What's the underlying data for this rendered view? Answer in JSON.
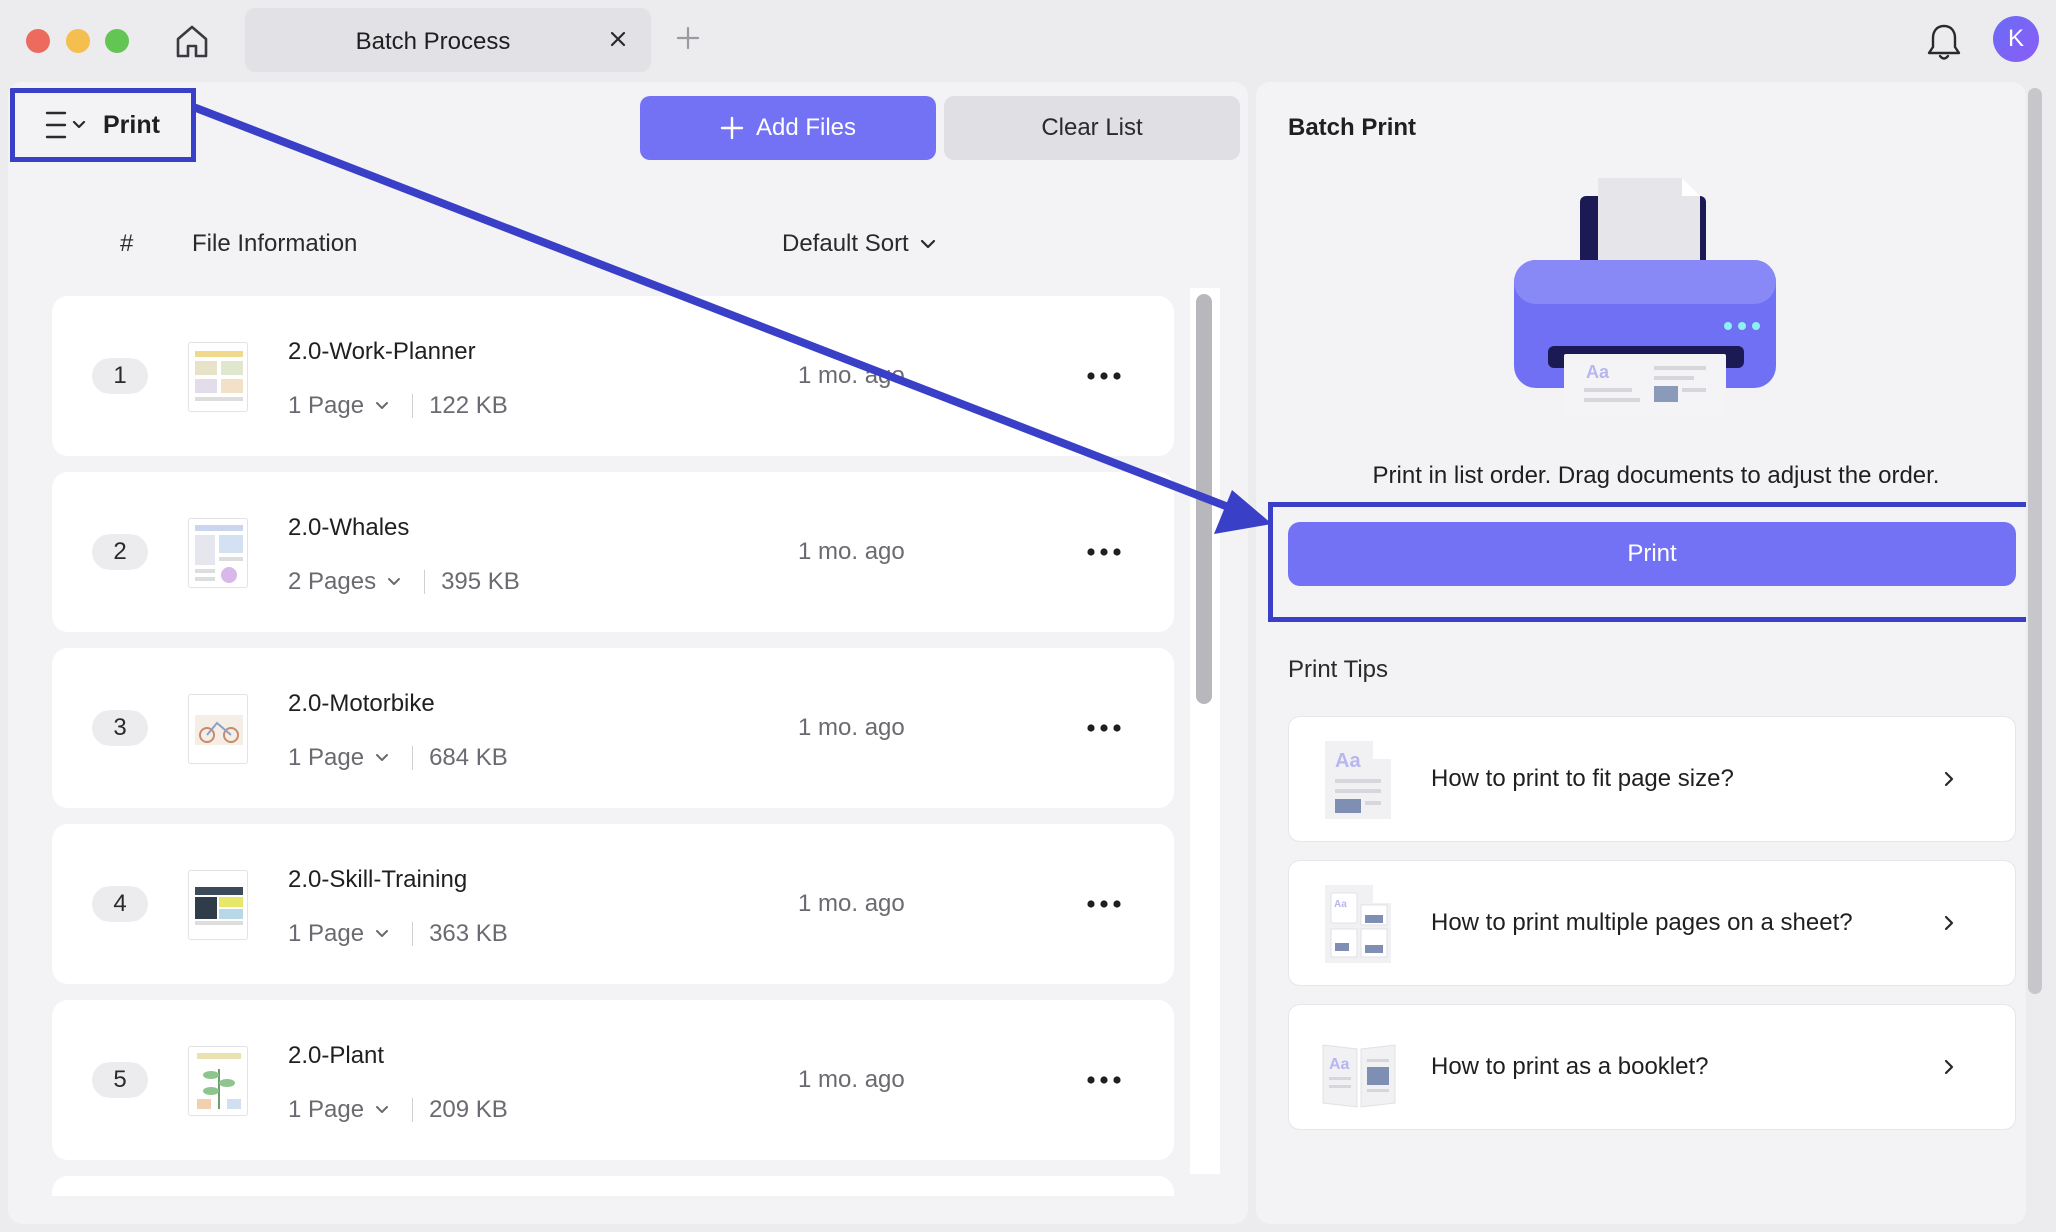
{
  "window": {
    "tab_title": "Batch Process",
    "avatar_initial": "K"
  },
  "colors": {
    "accent": "#7372f5",
    "annotation": "#3a3fc8",
    "traffic_red": "#ed6a5e",
    "traffic_yellow": "#f5bf4f",
    "traffic_green": "#62c554"
  },
  "toolbar": {
    "mode_label": "Print",
    "add_files_label": "Add Files",
    "clear_list_label": "Clear List"
  },
  "list": {
    "header": {
      "number": "#",
      "info": "File Information",
      "sort": "Default Sort"
    },
    "files": [
      {
        "index": "1",
        "name": "2.0-Work-Planner",
        "pages": "1 Page",
        "size": "122 KB",
        "modified": "1 mo. ago",
        "thumb": "planner"
      },
      {
        "index": "2",
        "name": "2.0-Whales",
        "pages": "2 Pages",
        "size": "395 KB",
        "modified": "1 mo. ago",
        "thumb": "whales"
      },
      {
        "index": "3",
        "name": "2.0-Motorbike",
        "pages": "1 Page",
        "size": "684 KB",
        "modified": "1 mo. ago",
        "thumb": "motorbike"
      },
      {
        "index": "4",
        "name": "2.0-Skill-Training",
        "pages": "1 Page",
        "size": "363 KB",
        "modified": "1 mo. ago",
        "thumb": "training"
      },
      {
        "index": "5",
        "name": "2.0-Plant",
        "pages": "1 Page",
        "size": "209 KB",
        "modified": "1 mo. ago",
        "thumb": "plant"
      }
    ]
  },
  "right_panel": {
    "title": "Batch Print",
    "description": "Print in list order. Drag documents to adjust the order.",
    "print_label": "Print",
    "tips_title": "Print Tips",
    "tips": [
      {
        "label": "How to print to fit page size?"
      },
      {
        "label": "How to print multiple pages on a sheet?"
      },
      {
        "label": "How to print as a booklet?"
      }
    ]
  },
  "icons": {
    "home": "home-icon",
    "close_tab": "close-icon",
    "new_tab": "plus-icon",
    "notifications": "bell-icon",
    "mode_menu": "menu-icon",
    "add": "plus-icon",
    "sort": "chevron-down-icon",
    "more": "more-dots-icon",
    "tip_open": "chevron-right-icon"
  }
}
